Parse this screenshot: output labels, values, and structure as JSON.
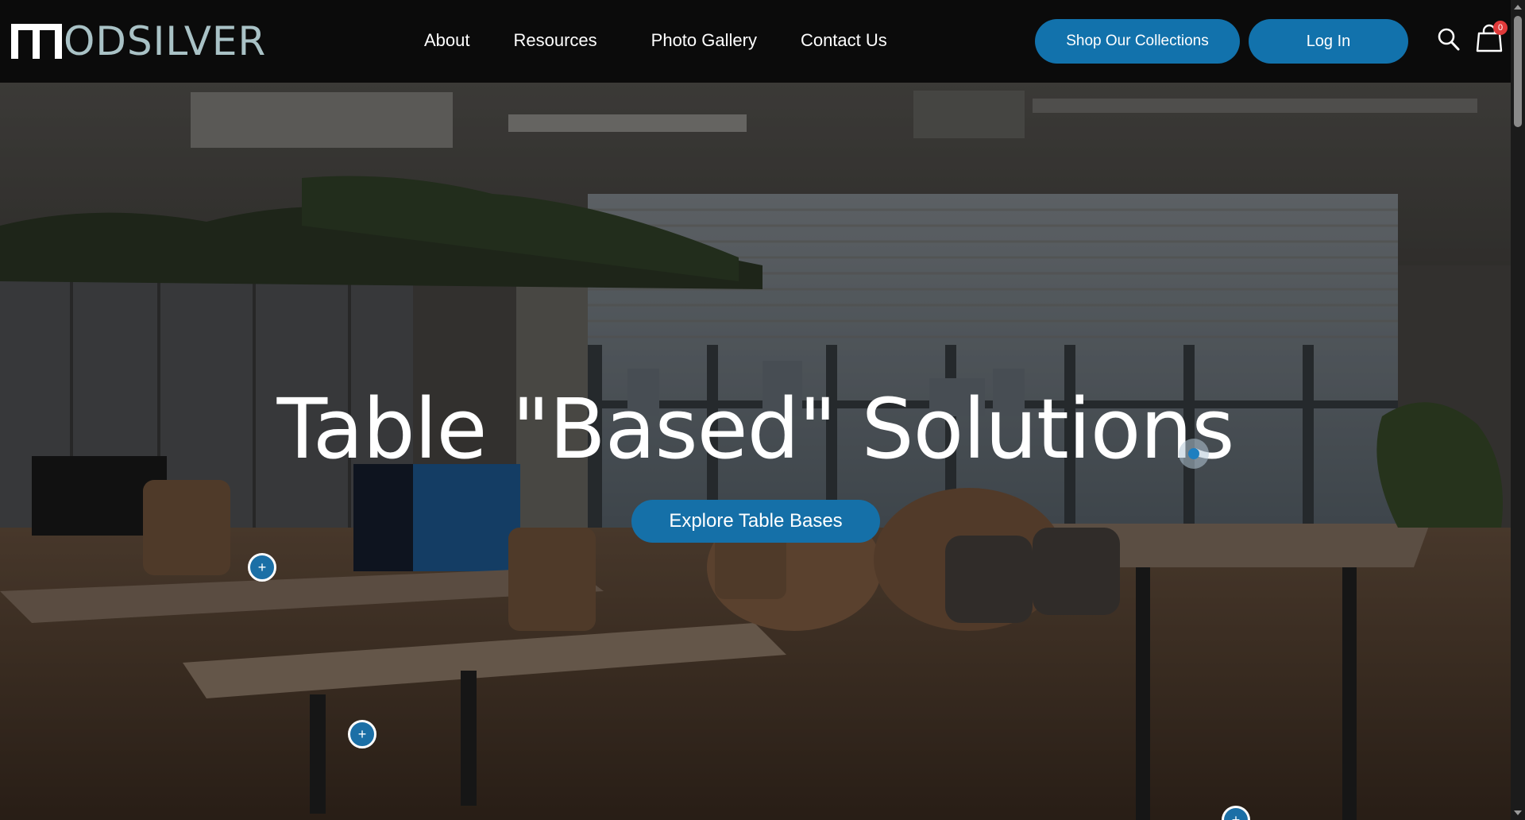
{
  "header": {
    "logo_text": "ODSILVER",
    "logo_icon": "modsilver-m-logo-icon",
    "nav": [
      {
        "label": "About"
      },
      {
        "label": "Resources"
      },
      {
        "label": "Photo Gallery"
      },
      {
        "label": "Contact Us"
      }
    ],
    "shop_button_label": "Shop Our Collections",
    "login_button_label": "Log In",
    "search_icon": "search-icon",
    "cart_icon": "shopping-bag-icon",
    "cart_count": "0"
  },
  "hero": {
    "title": "Table \"Based\" Solutions",
    "cta_label": "Explore Table Bases",
    "hotspots": [
      {
        "label": "+"
      },
      {
        "label": "+"
      },
      {
        "label": "+"
      }
    ]
  },
  "colors": {
    "accent": "#1272ac",
    "header_bg": "#0b0b0b",
    "logo_text": "#a9c2c6",
    "badge": "#e03a3a"
  }
}
